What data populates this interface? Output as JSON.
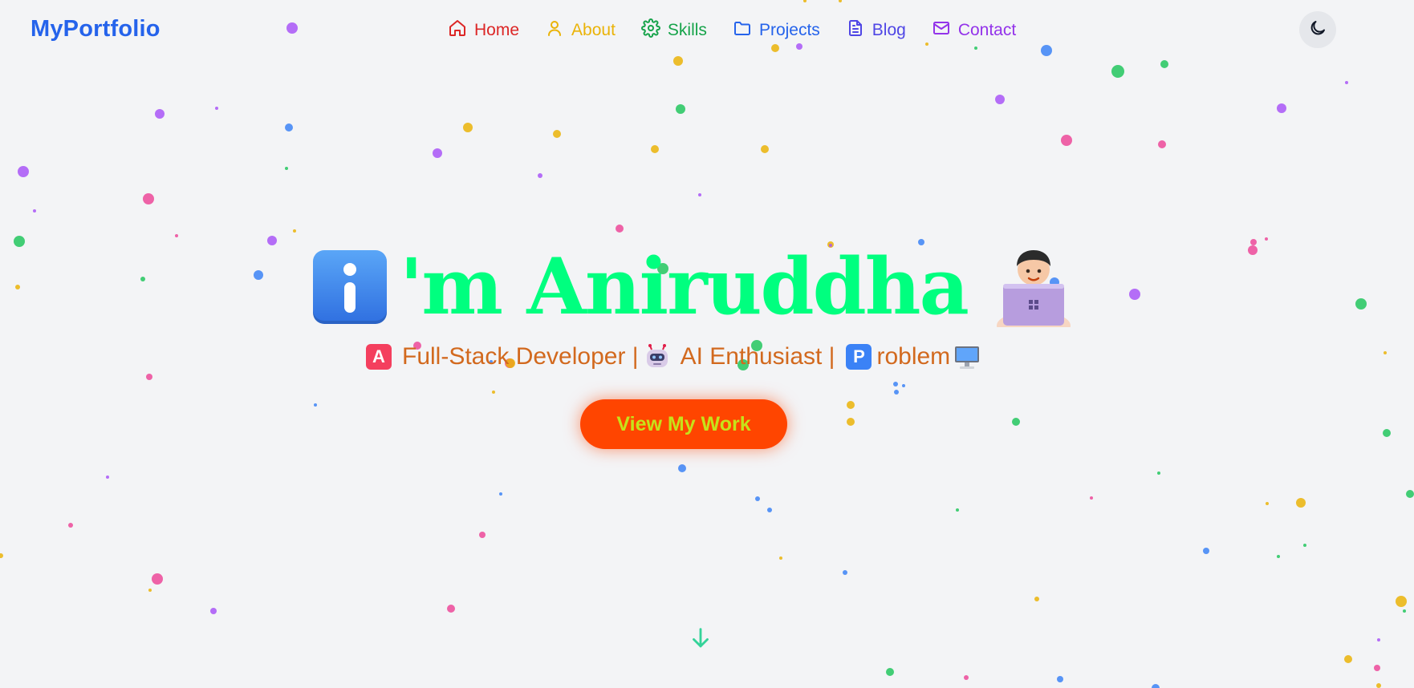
{
  "brand": {
    "name": "MyPortfolio",
    "color": "#2563eb"
  },
  "nav": {
    "items": [
      {
        "label": "Home",
        "icon": "home-icon",
        "color": "#dc2626"
      },
      {
        "label": "About",
        "icon": "user-icon",
        "color": "#eab308"
      },
      {
        "label": "Skills",
        "icon": "gear-icon",
        "color": "#16a34a"
      },
      {
        "label": "Projects",
        "icon": "folder-icon",
        "color": "#2563eb"
      },
      {
        "label": "Blog",
        "icon": "document-icon",
        "color": "#4f46e5"
      },
      {
        "label": "Contact",
        "icon": "mail-icon",
        "color": "#9333ea"
      }
    ]
  },
  "theme_toggle": {
    "icon": "moon-icon"
  },
  "hero": {
    "title": "'m Aniruddha",
    "title_color": "#00ff7f",
    "lead_emoji": "information-emoji",
    "trail_emoji": "technologist-emoji",
    "subtitle": {
      "color": "#d2691e",
      "parts": [
        {
          "tile": "A",
          "tile_color": "#f43f5e",
          "text": "Full-Stack Developer |"
        },
        {
          "emoji": "robot-emoji",
          "text": "AI Enthusiast |"
        },
        {
          "tile": "P",
          "tile_color": "#3b82f6",
          "text": "roblem"
        }
      ],
      "end_emoji": "desktop-computer-emoji"
    }
  },
  "cta": {
    "label": "View My Work",
    "bg": "#ff4500",
    "text_color": "#c6e21a"
  },
  "scroll_indicator": {
    "icon": "arrow-down-icon",
    "color": "#34d399"
  },
  "particle_colors": [
    "#3b82f6",
    "#22c55e",
    "#eab308",
    "#ec4899",
    "#a855f7"
  ]
}
